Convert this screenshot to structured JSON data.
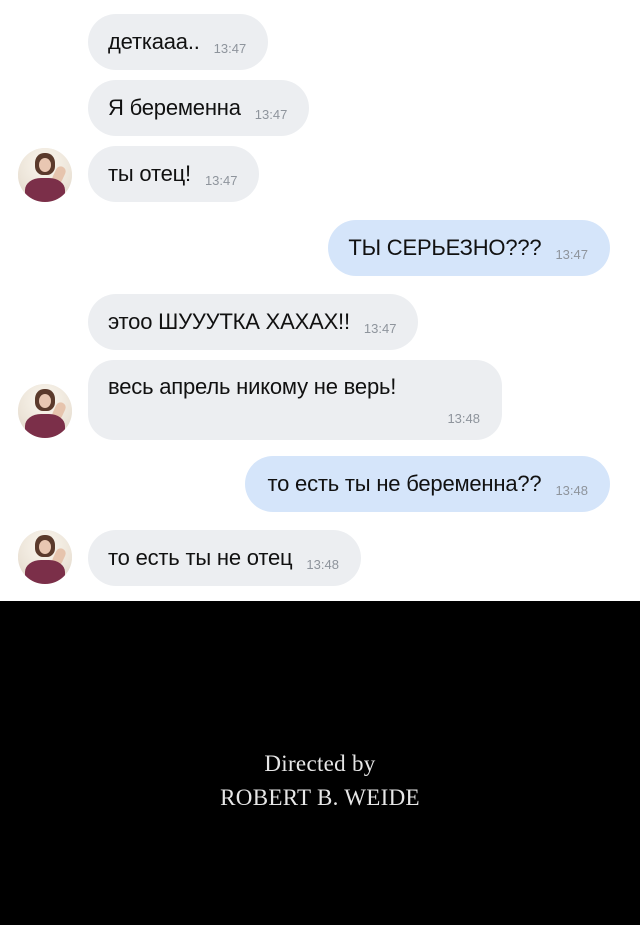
{
  "chat": {
    "messages": [
      {
        "text": "деткааа..",
        "time": "13:47",
        "direction": "incoming"
      },
      {
        "text": "Я беременна",
        "time": "13:47",
        "direction": "incoming"
      },
      {
        "text": "ты отец!",
        "time": "13:47",
        "direction": "incoming"
      },
      {
        "text": "ТЫ СЕРЬЕЗНО???",
        "time": "13:47",
        "direction": "outgoing"
      },
      {
        "text": "этоо ШУУУТКА ХАХАХ!!",
        "time": "13:47",
        "direction": "incoming"
      },
      {
        "text": "весь апрель никому не верь!",
        "time": "13:48",
        "direction": "incoming"
      },
      {
        "text": "то есть ты не беременна??",
        "time": "13:48",
        "direction": "outgoing"
      },
      {
        "text": "то есть ты не отец",
        "time": "13:48",
        "direction": "incoming"
      }
    ],
    "colors": {
      "incoming_bubble": "#eceef1",
      "outgoing_bubble": "#d5e5fa",
      "timestamp": "#8e949c"
    }
  },
  "credits": {
    "line1": "Directed by",
    "line2": "ROBERT B. WEIDE",
    "background": "#000000"
  }
}
